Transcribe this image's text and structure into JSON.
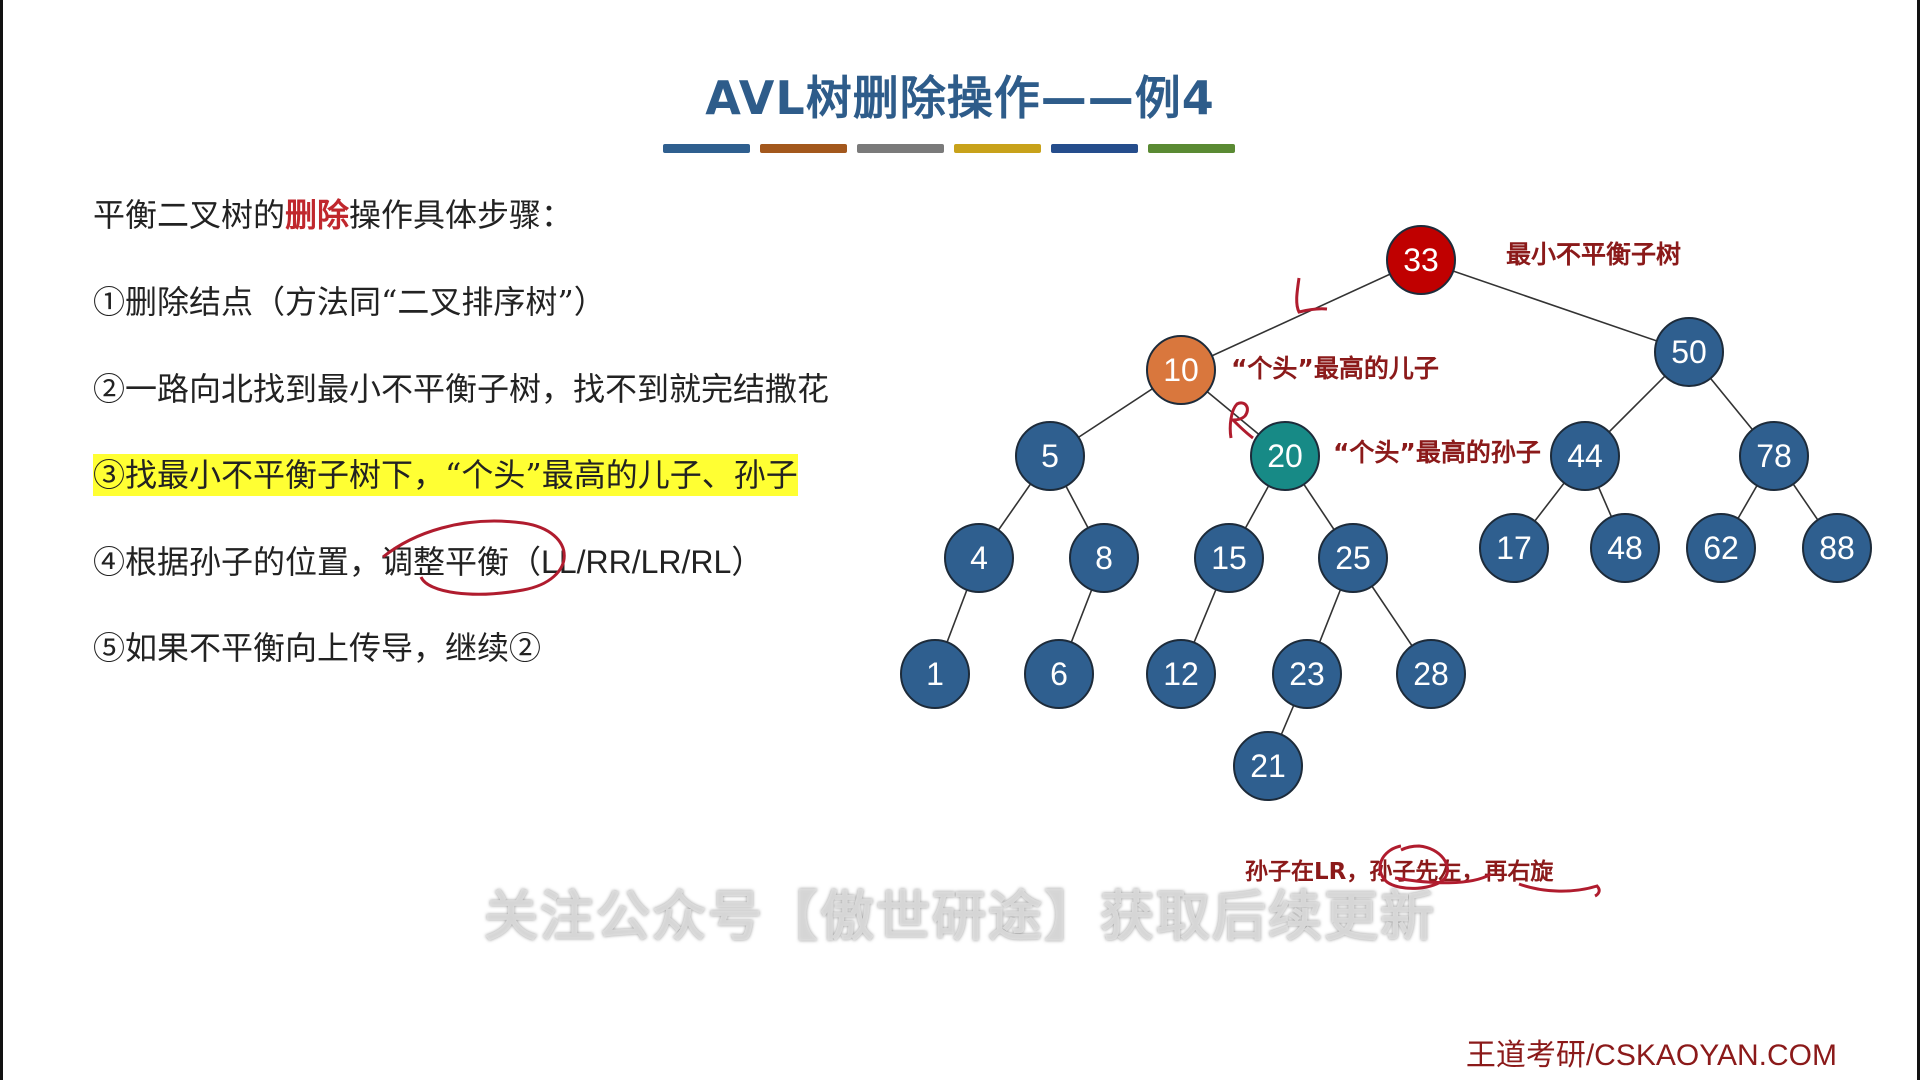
{
  "title": "AVL树删除操作——例4",
  "color_bar": [
    "#2f5f8f",
    "#a3581d",
    "#7a7a7a",
    "#c8a21a",
    "#254d8c",
    "#5a8a33"
  ],
  "steps": {
    "intro_prefix": "平衡二叉树的",
    "intro_red": "删除",
    "intro_suffix": "操作具体步骤：",
    "s1": "①删除结点（方法同“二叉排序树”）",
    "s2": "②一路向北找到最小不平衡子树，找不到就完结撒花",
    "s3": "③找最小不平衡子树下，“个头”最高的儿子、孙子",
    "s4_prefix": "④根据孙子的位置，",
    "s4_mid": "调整平衡",
    "s4_suffix": "（LL/RR/LR/RL）",
    "s5": "⑤如果不平衡向上传导，继续②"
  },
  "tree": {
    "nodes": [
      {
        "id": "33",
        "label": "33",
        "color": "#c00000"
      },
      {
        "id": "10",
        "label": "10",
        "color": "#d9773d"
      },
      {
        "id": "50",
        "label": "50",
        "color": "#2f5f8f"
      },
      {
        "id": "5",
        "label": "5",
        "color": "#2f5f8f"
      },
      {
        "id": "20",
        "label": "20",
        "color": "#178a86"
      },
      {
        "id": "44",
        "label": "44",
        "color": "#2f5f8f"
      },
      {
        "id": "78",
        "label": "78",
        "color": "#2f5f8f"
      },
      {
        "id": "4",
        "label": "4",
        "color": "#2f5f8f"
      },
      {
        "id": "8",
        "label": "8",
        "color": "#2f5f8f"
      },
      {
        "id": "15",
        "label": "15",
        "color": "#2f5f8f"
      },
      {
        "id": "25",
        "label": "25",
        "color": "#2f5f8f"
      },
      {
        "id": "17",
        "label": "17",
        "color": "#2f5f8f"
      },
      {
        "id": "48",
        "label": "48",
        "color": "#2f5f8f"
      },
      {
        "id": "62",
        "label": "62",
        "color": "#2f5f8f"
      },
      {
        "id": "88",
        "label": "88",
        "color": "#2f5f8f"
      },
      {
        "id": "1",
        "label": "1",
        "color": "#2f5f8f"
      },
      {
        "id": "6",
        "label": "6",
        "color": "#2f5f8f"
      },
      {
        "id": "12",
        "label": "12",
        "color": "#2f5f8f"
      },
      {
        "id": "23",
        "label": "23",
        "color": "#2f5f8f"
      },
      {
        "id": "28",
        "label": "28",
        "color": "#2f5f8f"
      },
      {
        "id": "21",
        "label": "21",
        "color": "#2f5f8f"
      }
    ],
    "edges": [
      [
        "33",
        "10"
      ],
      [
        "33",
        "50"
      ],
      [
        "10",
        "5"
      ],
      [
        "10",
        "20"
      ],
      [
        "50",
        "44"
      ],
      [
        "50",
        "78"
      ],
      [
        "5",
        "4"
      ],
      [
        "5",
        "8"
      ],
      [
        "20",
        "15"
      ],
      [
        "20",
        "25"
      ],
      [
        "44",
        "17"
      ],
      [
        "44",
        "48"
      ],
      [
        "78",
        "62"
      ],
      [
        "78",
        "88"
      ],
      [
        "4",
        "1"
      ],
      [
        "8",
        "6"
      ],
      [
        "15",
        "12"
      ],
      [
        "25",
        "23"
      ],
      [
        "25",
        "28"
      ],
      [
        "23",
        "21"
      ]
    ]
  },
  "notes": {
    "min_unbalanced": "最小不平衡子树",
    "tallest_son": "“个头”最高的儿子",
    "tallest_grandson": "“个头”最高的孙子",
    "handwritten_L": "L",
    "handwritten_R": "R",
    "rotation_hint": "孙子在LR，孙子先左，再右旋"
  },
  "watermark": "关注公众号【傲世研途】获取后续更新",
  "footer": "王道考研/CSKAOYAN.COM"
}
